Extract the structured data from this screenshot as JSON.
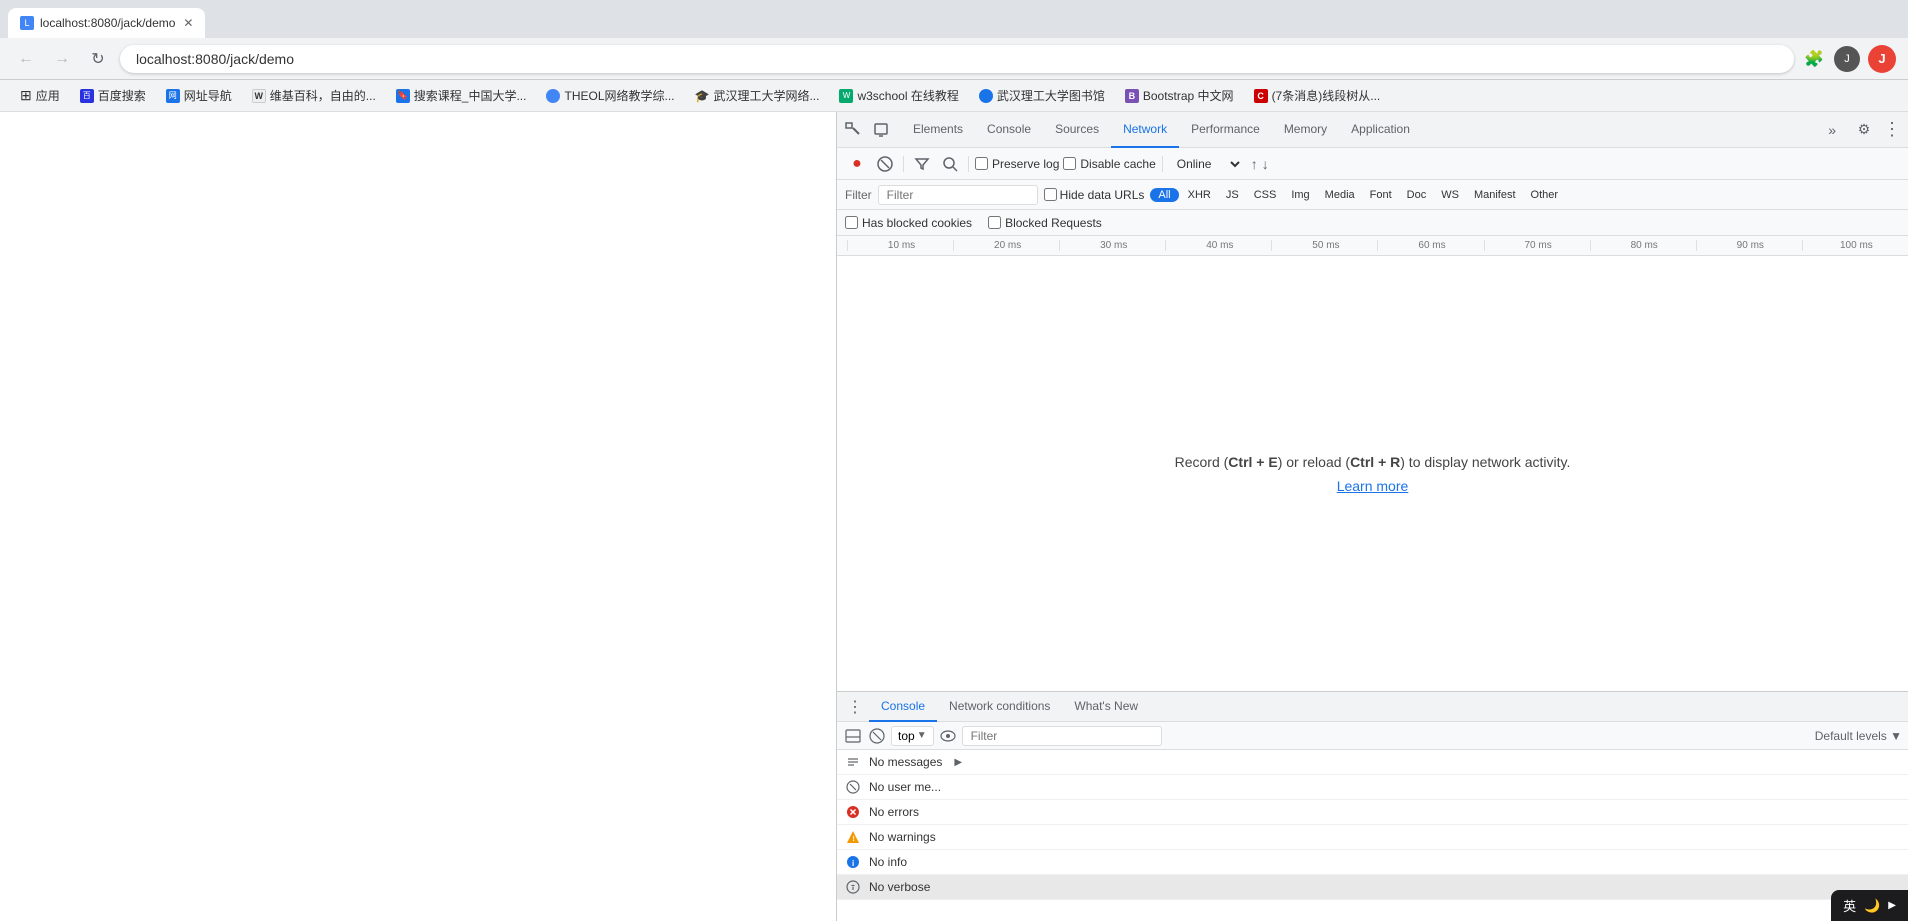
{
  "browser": {
    "tab_title": "localhost:8080/jack/demo",
    "tab_favicon_text": "L",
    "url": "localhost:8080/jack/demo",
    "cursor_visible": true
  },
  "bookmarks": [
    {
      "label": "应用",
      "favicon_color": "#e8710a"
    },
    {
      "label": "百度搜索",
      "favicon_color": "#2932e1"
    },
    {
      "label": "网址导航",
      "favicon_color": "#1a73e8"
    },
    {
      "label": "维基百科，自由的...",
      "favicon_color": "#333"
    },
    {
      "label": "搜索课程_中国大学...",
      "favicon_color": "#1a73e8"
    },
    {
      "label": "THEOL网络教学综...",
      "favicon_color": "#4285f4"
    },
    {
      "label": "武汉理工大学网络...",
      "favicon_color": "#1a73e8"
    },
    {
      "label": "w3school 在线教程",
      "favicon_color": "#04aa6d"
    },
    {
      "label": "武汉理工大学图书馆",
      "favicon_color": "#1a73e8"
    },
    {
      "label": "Bootstrap 中文网",
      "favicon_color": "#7952b3"
    },
    {
      "label": "(7条消息)线段树从...",
      "favicon_color": "#c00"
    }
  ],
  "devtools": {
    "tabs": [
      "Elements",
      "Console",
      "Sources",
      "Network",
      "Performance",
      "Memory",
      "Application"
    ],
    "active_tab": "Network",
    "more_tabs_label": "»",
    "settings_label": "⚙",
    "dock_label": "⋮"
  },
  "network": {
    "toolbar": {
      "record_label": "●",
      "clear_label": "🚫",
      "filter_label": "▽",
      "search_label": "🔍",
      "preserve_log_label": "Preserve log",
      "disable_cache_label": "Disable cache",
      "online_label": "Online",
      "import_label": "↑",
      "export_label": "↓"
    },
    "filter_bar": {
      "placeholder": "Filter",
      "hide_data_urls_label": "Hide data URLs",
      "tags": [
        "All",
        "XHR",
        "JS",
        "CSS",
        "Img",
        "Media",
        "Font",
        "Doc",
        "WS",
        "Manifest",
        "Other"
      ],
      "active_tag": "All"
    },
    "filter_bar2": {
      "has_blocked_cookies_label": "Has blocked cookies",
      "blocked_requests_label": "Blocked Requests"
    },
    "timeline": {
      "ticks": [
        "10 ms",
        "20 ms",
        "30 ms",
        "40 ms",
        "50 ms",
        "60 ms",
        "70 ms",
        "80 ms",
        "90 ms",
        "100 ms"
      ]
    },
    "empty_message": "Record (Ctrl + E) or reload (Ctrl + R) to display network activity.",
    "empty_link": "Learn more",
    "kbd_record": "Ctrl+E",
    "kbd_reload": "Ctrl+R"
  },
  "bottom_panel": {
    "tabs": [
      "Console",
      "Network conditions",
      "What's New"
    ],
    "active_tab": "Console",
    "more_btn": "⋮",
    "toolbar": {
      "clear_label": "🚫",
      "context_label": "top",
      "dropdown_label": "▼",
      "eye_label": "👁",
      "filter_placeholder": "Filter",
      "default_levels_label": "Default levels ▼"
    },
    "messages": [
      {
        "type": "messages",
        "icon": "≡",
        "text": "No messages",
        "icon_sym": "list"
      },
      {
        "type": "user",
        "icon": "⊘",
        "text": "No user me...",
        "icon_sym": "user"
      },
      {
        "type": "error",
        "icon": "✕",
        "text": "No errors",
        "icon_sym": "error"
      },
      {
        "type": "warning",
        "icon": "⚠",
        "text": "No warnings",
        "icon_sym": "warning"
      },
      {
        "type": "info",
        "icon": "ℹ",
        "text": "No info",
        "icon_sym": "info"
      },
      {
        "type": "verbose",
        "icon": "⚙",
        "text": "No verbose",
        "icon_sym": "verbose"
      }
    ]
  },
  "system_tray": {
    "lang": "英",
    "moon": "🌙",
    "more": "▶"
  }
}
